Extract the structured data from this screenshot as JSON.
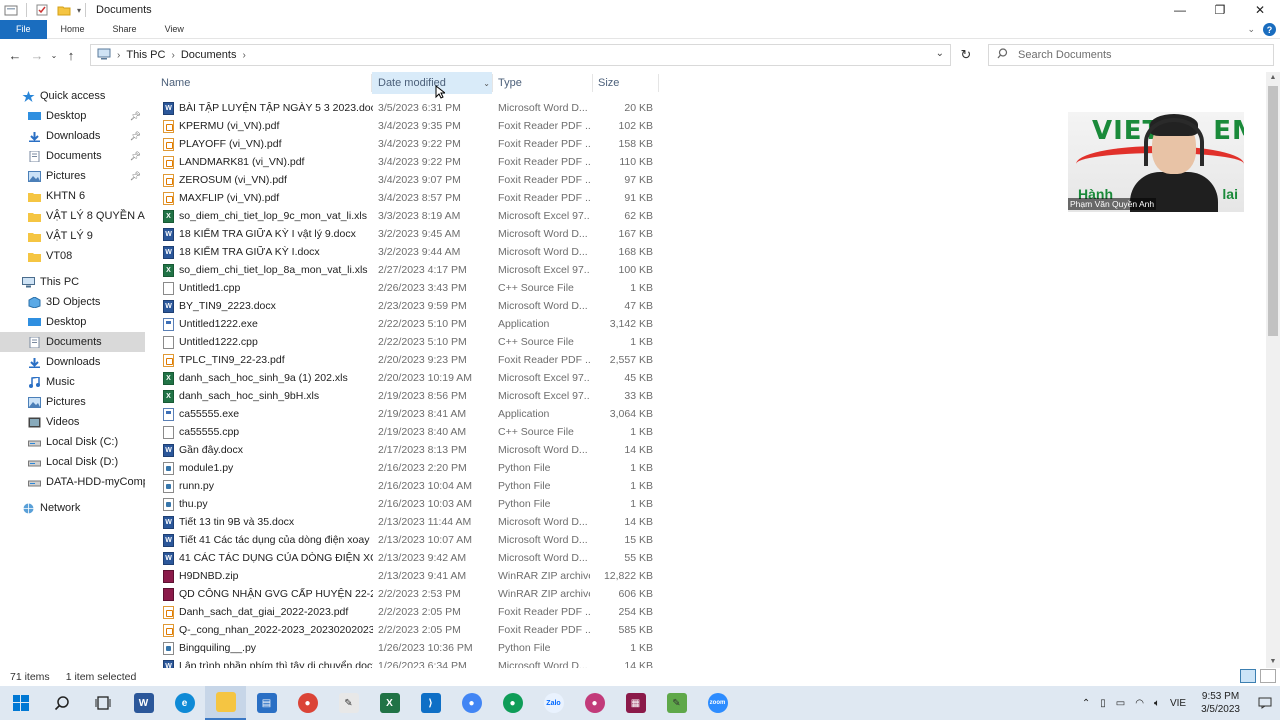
{
  "window": {
    "title": "Documents"
  },
  "ribbon": {
    "tabs": [
      "File",
      "Home",
      "Share",
      "View"
    ]
  },
  "address": {
    "crumbs": [
      "This PC",
      "Documents"
    ]
  },
  "search": {
    "placeholder": "Search Documents"
  },
  "sidebar": {
    "quick_access": "Quick access",
    "quick_items": [
      "Desktop",
      "Downloads",
      "Documents",
      "Pictures",
      "KHTN 6",
      "VẬT LÝ 8 QUYỀN ANH",
      "VẬT LÝ 9",
      "VT08"
    ],
    "this_pc": "This PC",
    "pc_items": [
      "3D Objects",
      "Desktop",
      "Documents",
      "Downloads",
      "Music",
      "Pictures",
      "Videos",
      "Local Disk (C:)",
      "Local Disk (D:)",
      "DATA-HDD-myCompu"
    ],
    "network": "Network"
  },
  "columns": {
    "name": "Name",
    "date": "Date modified",
    "type": "Type",
    "size": "Size"
  },
  "files": [
    {
      "name": "BÀI TẬP LUYỆN TẬP NGÀY 5 3 2023.docx",
      "date": "3/5/2023 6:31 PM",
      "type": "Microsoft Word D...",
      "size": "20 KB",
      "kind": "word"
    },
    {
      "name": "KPERMU (vi_VN).pdf",
      "date": "3/4/2023 9:35 PM",
      "type": "Foxit Reader PDF ...",
      "size": "102 KB",
      "kind": "pdf"
    },
    {
      "name": "PLAYOFF (vi_VN).pdf",
      "date": "3/4/2023 9:22 PM",
      "type": "Foxit Reader PDF ...",
      "size": "158 KB",
      "kind": "pdf"
    },
    {
      "name": "LANDMARK81 (vi_VN).pdf",
      "date": "3/4/2023 9:22 PM",
      "type": "Foxit Reader PDF ...",
      "size": "110 KB",
      "kind": "pdf"
    },
    {
      "name": "ZEROSUM (vi_VN).pdf",
      "date": "3/4/2023 9:07 PM",
      "type": "Foxit Reader PDF ...",
      "size": "97 KB",
      "kind": "pdf"
    },
    {
      "name": "MAXFLIP (vi_VN).pdf",
      "date": "3/4/2023 8:57 PM",
      "type": "Foxit Reader PDF ...",
      "size": "91 KB",
      "kind": "pdf"
    },
    {
      "name": "so_diem_chi_tiet_lop_9c_mon_vat_li.xls",
      "date": "3/3/2023 8:19 AM",
      "type": "Microsoft Excel 97...",
      "size": "62 KB",
      "kind": "excel"
    },
    {
      "name": "18 KIỂM TRA GIỮA KỲ I vật lý 9.docx",
      "date": "3/2/2023 9:45 AM",
      "type": "Microsoft Word D...",
      "size": "167 KB",
      "kind": "word"
    },
    {
      "name": "18 KIỂM TRA GIỮA KỲ I.docx",
      "date": "3/2/2023 9:44 AM",
      "type": "Microsoft Word D...",
      "size": "168 KB",
      "kind": "word"
    },
    {
      "name": "so_diem_chi_tiet_lop_8a_mon_vat_li.xls",
      "date": "2/27/2023 4:17 PM",
      "type": "Microsoft Excel 97...",
      "size": "100 KB",
      "kind": "excel"
    },
    {
      "name": "Untitled1.cpp",
      "date": "2/26/2023 3:43 PM",
      "type": "C++ Source File",
      "size": "1 KB",
      "kind": "cpp"
    },
    {
      "name": "BY_TIN9_2223.docx",
      "date": "2/23/2023 9:59 PM",
      "type": "Microsoft Word D...",
      "size": "47 KB",
      "kind": "word"
    },
    {
      "name": "Untitled1222.exe",
      "date": "2/22/2023 5:10 PM",
      "type": "Application",
      "size": "3,142 KB",
      "kind": "exe"
    },
    {
      "name": "Untitled1222.cpp",
      "date": "2/22/2023 5:10 PM",
      "type": "C++ Source File",
      "size": "1 KB",
      "kind": "cpp"
    },
    {
      "name": "TPLC_TIN9_22-23.pdf",
      "date": "2/20/2023 9:23 PM",
      "type": "Foxit Reader PDF ...",
      "size": "2,557 KB",
      "kind": "pdf"
    },
    {
      "name": "danh_sach_hoc_sinh_9a (1) 202.xls",
      "date": "2/20/2023 10:19 AM",
      "type": "Microsoft Excel 97...",
      "size": "45 KB",
      "kind": "excel"
    },
    {
      "name": "danh_sach_hoc_sinh_9bH.xls",
      "date": "2/19/2023 8:56 PM",
      "type": "Microsoft Excel 97...",
      "size": "33 KB",
      "kind": "excel"
    },
    {
      "name": "ca55555.exe",
      "date": "2/19/2023 8:41 AM",
      "type": "Application",
      "size": "3,064 KB",
      "kind": "exe"
    },
    {
      "name": "ca55555.cpp",
      "date": "2/19/2023 8:40 AM",
      "type": "C++ Source File",
      "size": "1 KB",
      "kind": "cpp"
    },
    {
      "name": "Gần đây.docx",
      "date": "2/17/2023 8:13 PM",
      "type": "Microsoft Word D...",
      "size": "14 KB",
      "kind": "word"
    },
    {
      "name": "module1.py",
      "date": "2/16/2023 2:20 PM",
      "type": "Python File",
      "size": "1 KB",
      "kind": "py"
    },
    {
      "name": "runn.py",
      "date": "2/16/2023 10:04 AM",
      "type": "Python File",
      "size": "1 KB",
      "kind": "py"
    },
    {
      "name": "thu.py",
      "date": "2/16/2023 10:03 AM",
      "type": "Python File",
      "size": "1 KB",
      "kind": "py"
    },
    {
      "name": "Tiết 13 tin 9B và 35.docx",
      "date": "2/13/2023 11:44 AM",
      "type": "Microsoft Word D...",
      "size": "14 KB",
      "kind": "word"
    },
    {
      "name": "Tiết 41 Các tác dụng của dòng điện xoay ...",
      "date": "2/13/2023 10:07 AM",
      "type": "Microsoft Word D...",
      "size": "15 KB",
      "kind": "word"
    },
    {
      "name": "41 CÁC TÁC DỤNG CỦA DÒNG ĐIỆN XO...",
      "date": "2/13/2023 9:42 AM",
      "type": "Microsoft Word D...",
      "size": "55 KB",
      "kind": "word"
    },
    {
      "name": "H9DNBD.zip",
      "date": "2/13/2023 9:41 AM",
      "type": "WinRAR ZIP archive",
      "size": "12,822 KB",
      "kind": "zip"
    },
    {
      "name": "QD CÔNG NHẬN GVG CẤP HUYỆN 22-23....",
      "date": "2/2/2023 2:53 PM",
      "type": "WinRAR ZIP archive",
      "size": "606 KB",
      "kind": "zip"
    },
    {
      "name": "Danh_sach_dat_giai_2022-2023.pdf",
      "date": "2/2/2023 2:05 PM",
      "type": "Foxit Reader PDF ...",
      "size": "254 KB",
      "kind": "pdf"
    },
    {
      "name": "Q-_cong_nhan_2022-2023_202302020230....",
      "date": "2/2/2023 2:05 PM",
      "type": "Foxit Reader PDF ...",
      "size": "585 KB",
      "kind": "pdf"
    },
    {
      "name": "Bingquiling__.py",
      "date": "1/26/2023 10:36 PM",
      "type": "Python File",
      "size": "1 KB",
      "kind": "py"
    },
    {
      "name": "Lập trình phần phím thì tây di chuyển.docx",
      "date": "1/26/2023 6:34 PM",
      "type": "Microsoft Word D...",
      "size": "14 KB",
      "kind": "word"
    }
  ],
  "status": {
    "count": "71 items",
    "selected": "1 item selected"
  },
  "webcam": {
    "name": "Phạm Văn Quyền Anh",
    "logo": "VIET",
    "logo_tail": "EM",
    "sub_left": "Hành",
    "sub_right": "lai"
  },
  "taskbar": {
    "apps": [
      "start",
      "search",
      "task-view",
      "word",
      "edge",
      "file-explorer",
      "store",
      "chrome",
      "paint",
      "excel",
      "vscode",
      "chrome-profile-a",
      "chrome-profile-b",
      "zalo",
      "chrome-profile-c",
      "winrar",
      "notepadpp",
      "zoom"
    ],
    "lang": "VIE",
    "time": "9:53 PM",
    "date": "3/5/2023"
  },
  "colors": {
    "accent": "#1a6dbf",
    "selected_sidebar": "#d9d9d9",
    "sorted_header": "#d9ebf9"
  }
}
